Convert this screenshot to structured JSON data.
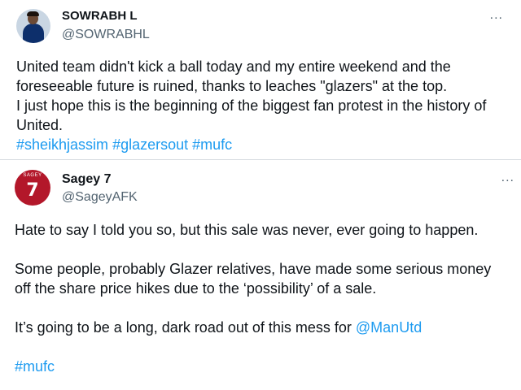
{
  "tweets": [
    {
      "display_name": "SOWRABH L",
      "handle": "@SOWRABHL",
      "more_icon": "...",
      "lines": [
        "United team didn't kick a ball today and my entire weekend and the",
        "foreseeable future is ruined, thanks to leaches \"glazers\" at the top.",
        "I just hope this is the beginning of the biggest fan protest in the history of",
        "United."
      ],
      "hashtags": [
        "#sheikhjassim",
        "#glazersout",
        "#mufc"
      ]
    },
    {
      "display_name": "Sagey 7",
      "handle": "@SageyAFK",
      "more_icon": "...",
      "avatar_text": "SAGEY",
      "avatar_number": "7",
      "para1": "Hate to say I told you so, but this sale was never, ever going to happen.",
      "para2_line1": "Some people, probably Glazer relatives, have made some serious money",
      "para2_line2": "off the share price hikes due to the ‘possibility’ of a sale.",
      "para3_text": "It’s going to be a long, dark road out of this mess for ",
      "para3_mention": "@ManUtd",
      "hashtag": "#mufc"
    }
  ],
  "colors": {
    "text": "#0f1419",
    "secondary": "#536471",
    "link": "#1d9bf0",
    "avatar2_bg": "#b3172a"
  },
  "icons": {
    "more": "more-horizontal-icon"
  }
}
